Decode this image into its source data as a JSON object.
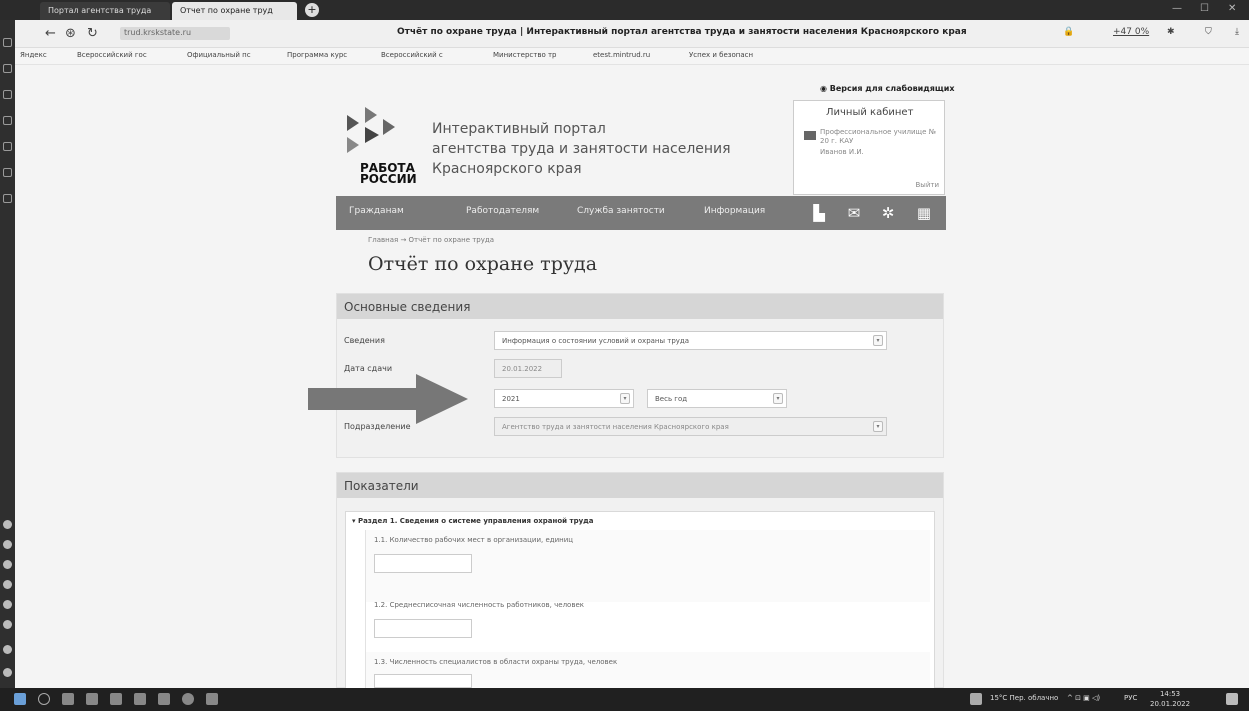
{
  "browser": {
    "tab_inactive": "Портал агентства труда",
    "tab_active": "Отчет по охране труд",
    "new_tab": "+",
    "url": "trud.krskstate.ru",
    "page_title": "Отчёт по охране труда | Интерактивный портал агентства труда и занятости населения Красноярского края",
    "zoom": "+47 0%",
    "bookmarks": [
      "Яндекс",
      "Всероссийский гос",
      "Официальный пс",
      "Программа курс",
      "Всероссийский с",
      "Министерство тр",
      "etest.mintrud.ru",
      "Успех и безопасн"
    ]
  },
  "site": {
    "a11y_link": "Версия для слабовидящих",
    "logo_line1": "РАБОТА",
    "logo_line2": "РОССИИ",
    "portal_title_1": "Интерактивный портал",
    "portal_title_2": "агентства труда и занятости населения",
    "portal_title_3": "Красноярского края",
    "cabinet": {
      "title": "Личный кабинет",
      "org": "Профессиональное училище № 20 г. КАУ",
      "user": "Иванов И.И.",
      "logout": "Выйти"
    },
    "menu": [
      "Гражданам",
      "Работодателям",
      "Служба занятости",
      "Информация"
    ]
  },
  "page": {
    "breadcrumb": "Главная → Отчёт по охране труда",
    "heading": "Отчёт по охране труда"
  },
  "basic_info": {
    "title": "Основные сведения",
    "svedeniya_label": "Сведения",
    "svedeniya_value": "Информация о состоянии условий и охраны труда",
    "date_label": "Дата сдачи",
    "date_value": "20.01.2022",
    "year_value": "2021",
    "period_value": "Весь год",
    "dept_label": "Подразделение",
    "dept_value": "Агентство труда и занятости населения Красноярского края"
  },
  "indicators": {
    "title": "Показатели",
    "section1": "Раздел 1. Сведения о системе управления охраной труда",
    "items": [
      "1.1. Количество рабочих мест в организации, единиц",
      "1.2. Среднесписочная численность работников, человек",
      "1.3. Численность специалистов в области охраны труда, человек"
    ]
  },
  "taskbar": {
    "weather": "15°C Пер. облачно",
    "lang": "РУС",
    "time": "14:53",
    "date": "20.01.2022"
  }
}
